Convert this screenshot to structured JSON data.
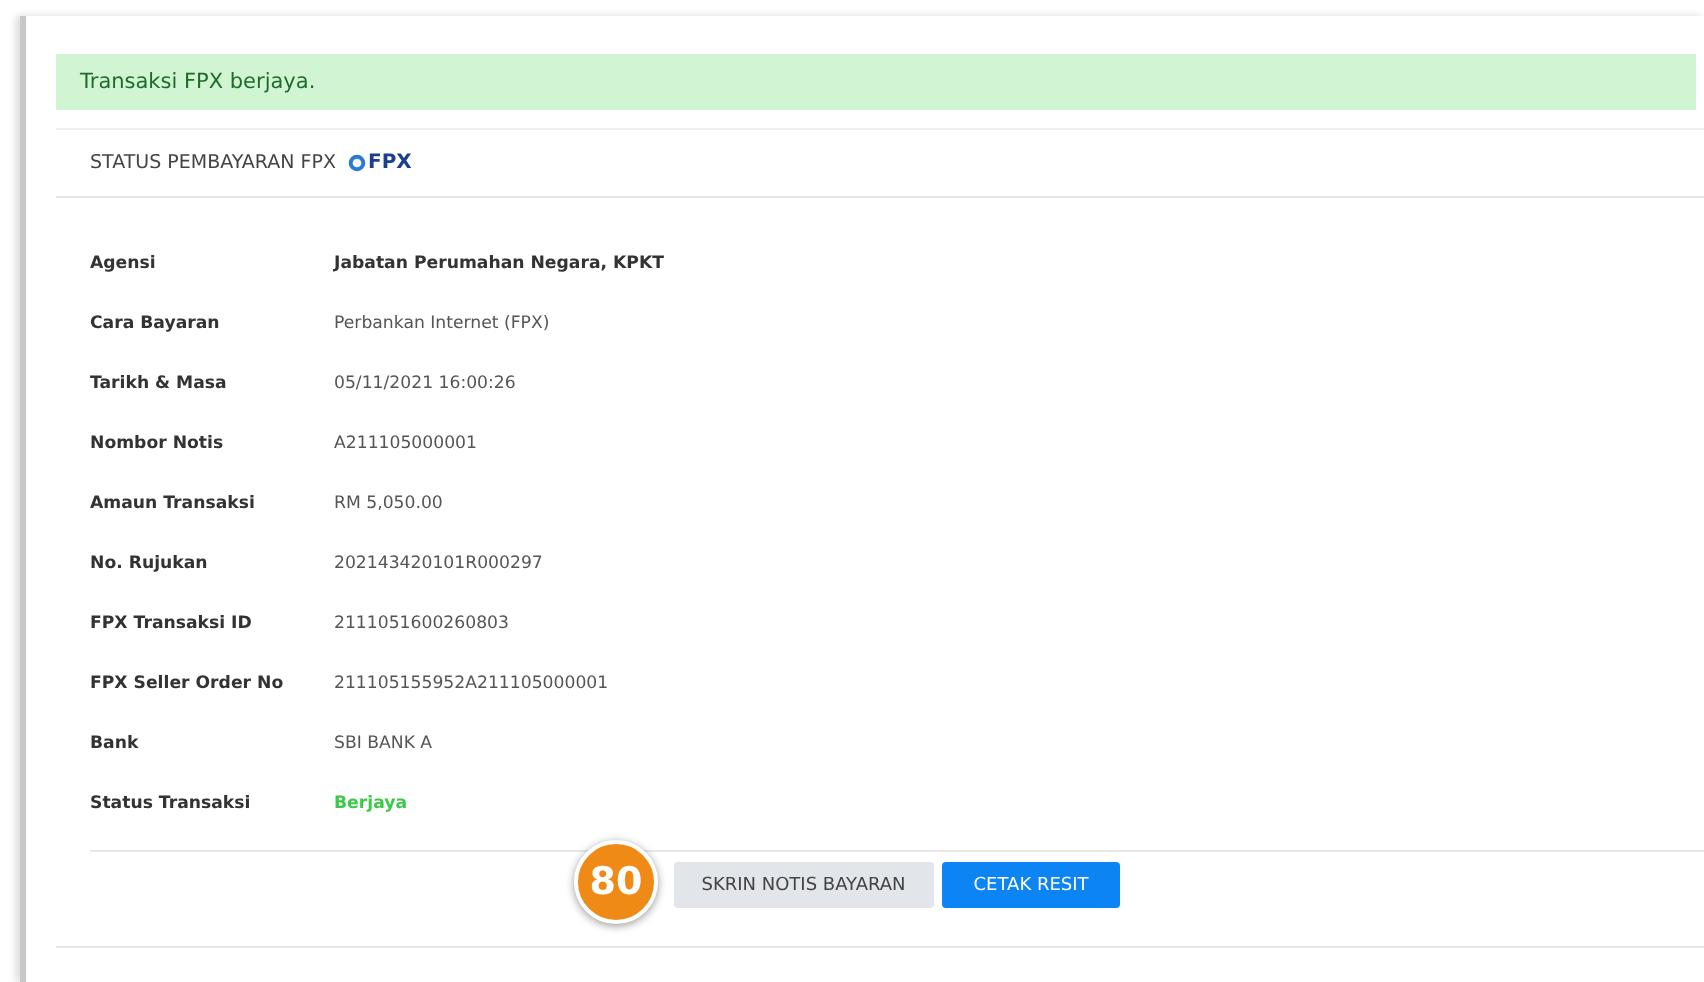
{
  "alert": {
    "message": "Transaksi FPX berjaya."
  },
  "card": {
    "title": "STATUS PEMBAYARAN FPX",
    "logo_text": "FPX"
  },
  "details": [
    {
      "label": "Agensi",
      "value": "Jabatan Perumahan Negara, KPKT",
      "kind": "bold"
    },
    {
      "label": "Cara Bayaran",
      "value": "Perbankan Internet (FPX)",
      "kind": "plain"
    },
    {
      "label": "Tarikh & Masa",
      "value": "05/11/2021 16:00:26",
      "kind": "plain"
    },
    {
      "label": "Nombor Notis",
      "value": "A211105000001",
      "kind": "plain"
    },
    {
      "label": "Amaun Transaksi",
      "value": "RM 5,050.00",
      "kind": "plain"
    },
    {
      "label": "No. Rujukan",
      "value": "202143420101R000297",
      "kind": "plain"
    },
    {
      "label": "FPX Transaksi ID",
      "value": "2111051600260803",
      "kind": "plain"
    },
    {
      "label": "FPX Seller Order No",
      "value": "211105155952A211105000001",
      "kind": "plain"
    },
    {
      "label": "Bank",
      "value": "SBI BANK A",
      "kind": "plain"
    },
    {
      "label": "Status Transaksi",
      "value": "Berjaya",
      "kind": "success"
    }
  ],
  "buttons": [
    {
      "label": "SKRIN NOTIS BAYARAN",
      "kind": "secondary"
    },
    {
      "label": "CETAK RESIT",
      "kind": "primary"
    }
  ],
  "step_badge": "80"
}
